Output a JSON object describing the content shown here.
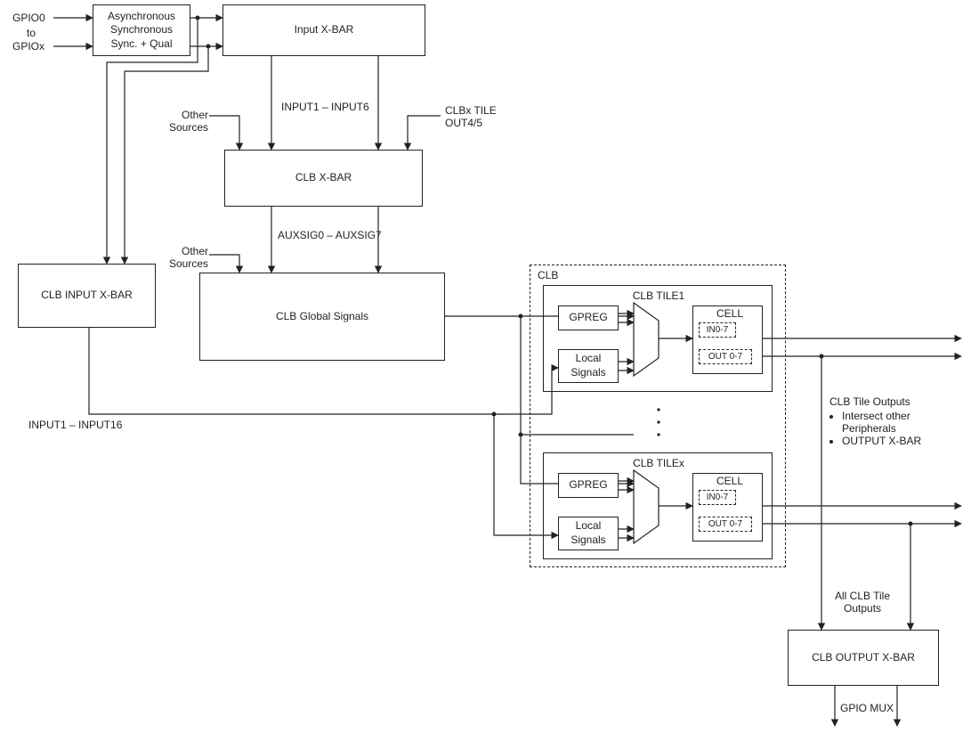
{
  "inputs": {
    "gpio0": "GPIO0",
    "to": "to",
    "gpiox": "GPIOx"
  },
  "blocks": {
    "sync": "Asynchronous\nSynchronous\nSync. + Qual",
    "input_xbar": "Input X-BAR",
    "clb_xbar": "CLB X-BAR",
    "clb_input_xbar": "CLB INPUT X-BAR",
    "clb_global": "CLB Global Signals",
    "clb_output_xbar": "CLB OUTPUT X-BAR",
    "clb_dashed_label": "CLB",
    "tile1_title": "CLB TILE1",
    "tilex_title": "CLB TILEx",
    "gpreg": "GPREG",
    "local_signals": "Local\nSignals",
    "cell": "CELL",
    "in07": "IN0-7",
    "out07": "OUT 0-7"
  },
  "labels": {
    "input1_6": "INPUT1 – INPUT6",
    "other_sources": "Other\nSources",
    "clbx_tile_out45": "CLBx TILE\nOUT4/5",
    "auxsig": "AUXSIG0 – AUXSIG7",
    "input1_16": "INPUT1 – INPUT16",
    "all_outputs": "All CLB Tile\nOutputs",
    "gpio_mux": "GPIO MUX",
    "tile_outputs_title": "CLB Tile Outputs",
    "bullet1": "Intersect other\nPeripherals",
    "bullet2": "OUTPUT X-BAR"
  }
}
